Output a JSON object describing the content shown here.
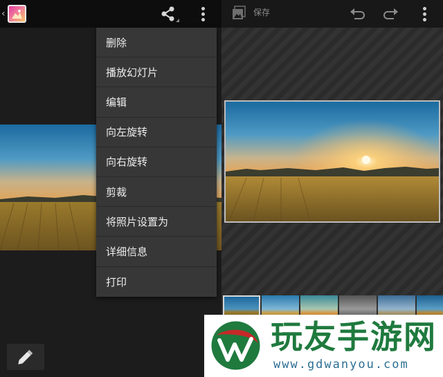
{
  "left": {
    "back_glyph": "‹",
    "icons": {
      "app": "gallery-app-icon",
      "share": "share-icon",
      "more": "overflow-icon",
      "edit": "pencil-icon"
    }
  },
  "menu": {
    "items": [
      "删除",
      "播放幻灯片",
      "编辑",
      "向左旋转",
      "向右旋转",
      "剪裁",
      "将照片设置为",
      "详细信息",
      "打印"
    ]
  },
  "right": {
    "save_label": "保存",
    "icons": {
      "save": "image-save-icon",
      "undo": "undo-icon",
      "redo": "redo-icon",
      "more": "overflow-icon"
    }
  },
  "filmstrip": {
    "thumbnail_count": 6,
    "selected_index": 0
  },
  "watermark": {
    "brand_name": "玩友手游网",
    "url": "www.gdwanyou.com",
    "colors": {
      "green": "#1f7a3e",
      "red": "#c62828",
      "blue": "#2b6e93"
    }
  }
}
